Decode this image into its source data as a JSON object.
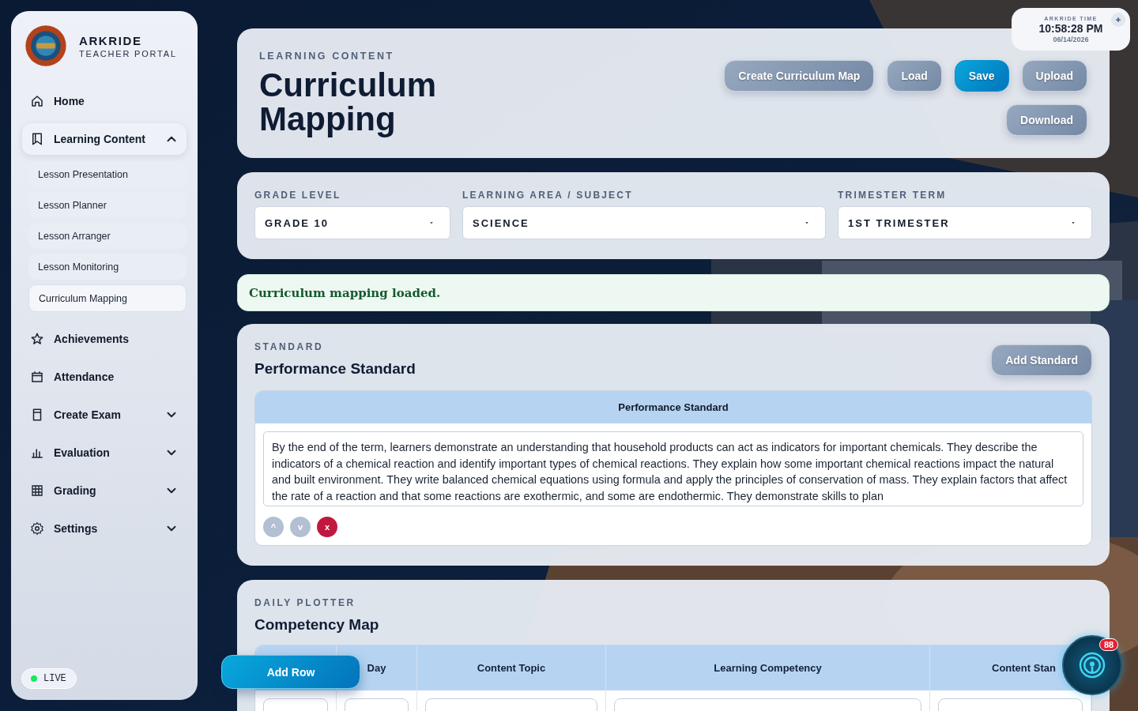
{
  "sidebar": {
    "brand": "ARKRIDE",
    "subtitle": "TEACHER PORTAL",
    "items": [
      {
        "label": "Home"
      },
      {
        "label": "Learning Content",
        "expanded": true,
        "children": [
          {
            "label": "Lesson Presentation",
            "selected": false
          },
          {
            "label": "Lesson Planner",
            "selected": false
          },
          {
            "label": "Lesson Arranger",
            "selected": false
          },
          {
            "label": "Lesson Monitoring",
            "selected": false
          },
          {
            "label": "Curriculum Mapping",
            "selected": true
          }
        ]
      },
      {
        "label": "Achievements"
      },
      {
        "label": "Attendance"
      },
      {
        "label": "Create Exam",
        "expanded": false
      },
      {
        "label": "Evaluation",
        "expanded": false
      },
      {
        "label": "Grading",
        "expanded": false
      },
      {
        "label": "Settings",
        "expanded": false
      }
    ],
    "status": {
      "label": "LIVE",
      "on": true
    }
  },
  "clock": {
    "label": "ARKRIDE TIME",
    "time": "10:58:28 PM",
    "date": "06/14/2026"
  },
  "header": {
    "eyebrow": "LEARNING CONTENT",
    "title": "Curriculum Mapping",
    "buttons": [
      {
        "label": "Create Curriculum Map",
        "primary": false
      },
      {
        "label": "Load",
        "primary": false
      },
      {
        "label": "Save",
        "primary": true
      },
      {
        "label": "Upload",
        "primary": false
      },
      {
        "label": "Download",
        "primary": false
      }
    ]
  },
  "filters": [
    {
      "label": "GRADE LEVEL",
      "value": "GRADE 10"
    },
    {
      "label": "LEARNING AREA / SUBJECT",
      "value": "SCIENCE"
    },
    {
      "label": "TRIMESTER TERM",
      "value": "1ST TRIMESTER"
    }
  ],
  "message": "Curriculum mapping loaded.",
  "standard": {
    "eyebrow": "STANDARD",
    "title": "Performance Standard",
    "button": "Add Standard",
    "column": "Performance Standard",
    "rows": [
      {
        "text": "By the end of the term, learners demonstrate an understanding that household products can act as indicators for important chemicals. They describe the indicators of a chemical reaction and identify important types of chemical reactions. They explain how some important chemical reactions impact the natural and built environment. They write balanced chemical equations using formula and apply the principles of conservation of mass. They explain factors that affect the rate of a reaction and that some reactions are exothermic, and some are endothermic. They demonstrate skills to plan",
        "controls": [
          {
            "label": "^",
            "kind": "up"
          },
          {
            "label": "v",
            "kind": "down"
          },
          {
            "label": "x",
            "kind": "delete"
          }
        ]
      }
    ]
  },
  "plotter": {
    "eyebrow": "DAILY PLOTTER",
    "title": "Competency Map",
    "add_button": "Add Row",
    "columns": [
      "Day",
      "Content Topic",
      "Learning Competency",
      "Content Stan"
    ]
  },
  "fab": {
    "badge": "88"
  }
}
